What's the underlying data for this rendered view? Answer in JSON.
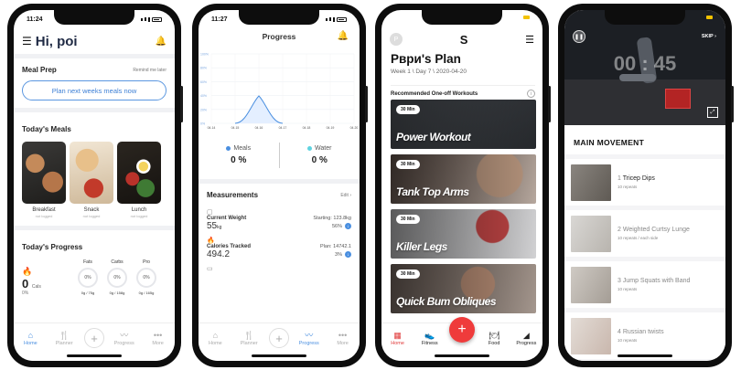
{
  "phones": [
    {
      "time": "11:24",
      "greeting": "Hi, poi",
      "meal_prep": {
        "title": "Meal Prep",
        "remind": "Remind me later",
        "cta": "Plan next weeks meals now"
      },
      "todays_meals": {
        "title": "Today's Meals",
        "items": [
          {
            "label": "Breakfast",
            "sub": "not logged"
          },
          {
            "label": "Snack",
            "sub": "not logged"
          },
          {
            "label": "Lunch",
            "sub": "not logged"
          }
        ]
      },
      "todays_progress": {
        "title": "Today's Progress",
        "cals_value": "0",
        "cals_unit": "Cals",
        "cals_pct": "0%",
        "macros": [
          {
            "name": "Fats",
            "pct": "0%",
            "amount": "0g / 75g"
          },
          {
            "name": "Carbs",
            "pct": "0%",
            "amount": "0g / 158g"
          },
          {
            "name": "Pro",
            "pct": "0%",
            "amount": "0g / 165g"
          }
        ]
      },
      "tabs": [
        {
          "label": "Home",
          "icon": "⌂"
        },
        {
          "label": "Planner",
          "icon": "🍴"
        },
        {
          "label": "Progress",
          "icon": "〰"
        },
        {
          "label": "More",
          "icon": "•••"
        }
      ]
    },
    {
      "time": "11:27",
      "title": "Progress",
      "chart_axis": {
        "y_ticks": [
          "100%",
          "80%",
          "60%",
          "40%",
          "20%",
          "0%"
        ],
        "x_ticks": [
          "04.14",
          "04.15",
          "04.16",
          "04.17",
          "04.18",
          "04.19",
          "04.20"
        ]
      },
      "meals": {
        "label": "Meals",
        "value": "0 %",
        "color": "#4a8fe0"
      },
      "water": {
        "label": "Water",
        "value": "0 %",
        "color": "#5ed3e0"
      },
      "measurements": {
        "title": "Measurements",
        "edit": "Edit",
        "items": [
          {
            "name": "Current Weight",
            "right": "Starting: 123.8kg",
            "value": "55",
            "unit": "kg",
            "pct": "56%"
          },
          {
            "name": "Calories Tracked",
            "right": "Plan: 14742.1",
            "value": "494.2",
            "unit": "",
            "pct": "3%"
          }
        ]
      },
      "tabs": [
        {
          "label": "Home",
          "icon": "⌂"
        },
        {
          "label": "Planner",
          "icon": "🍴"
        },
        {
          "label": "Progress",
          "icon": "〰"
        },
        {
          "label": "More",
          "icon": "•••"
        }
      ]
    },
    {
      "avatar": "P",
      "logo": "S",
      "plan_title": "Рври's Plan",
      "plan_sub": "Week 1 \\ Day 7 \\ 2020-04-20",
      "rec_title": "Recommended One-off Workouts",
      "workouts": [
        {
          "badge": "30 Min",
          "name": "Power Workout"
        },
        {
          "badge": "30 Min",
          "name": "Tank Top Arms"
        },
        {
          "badge": "30 Min",
          "name": "Killer Legs"
        },
        {
          "badge": "30 Min",
          "name": "Quick Bum Obliques"
        }
      ],
      "tabs": [
        {
          "label": "Home",
          "icon": "▦"
        },
        {
          "label": "Fitness",
          "icon": "👟"
        },
        {
          "label": "Food",
          "icon": "🍽"
        },
        {
          "label": "Progress",
          "icon": "◢"
        }
      ]
    },
    {
      "skip": "SKIP",
      "timer": "00 : 45",
      "section": "MAIN MOVEMENT",
      "exercises": [
        {
          "num": "1",
          "name": "Tricep Dips",
          "reps": "10 repeats"
        },
        {
          "num": "2",
          "name": "Weighted Curtsy Lunge",
          "reps": "10 repeats / each side"
        },
        {
          "num": "3",
          "name": "Jump Squats with Band",
          "reps": "10 repeats"
        },
        {
          "num": "4",
          "name": "Russian twists",
          "reps": "10 repeats"
        }
      ]
    }
  ]
}
